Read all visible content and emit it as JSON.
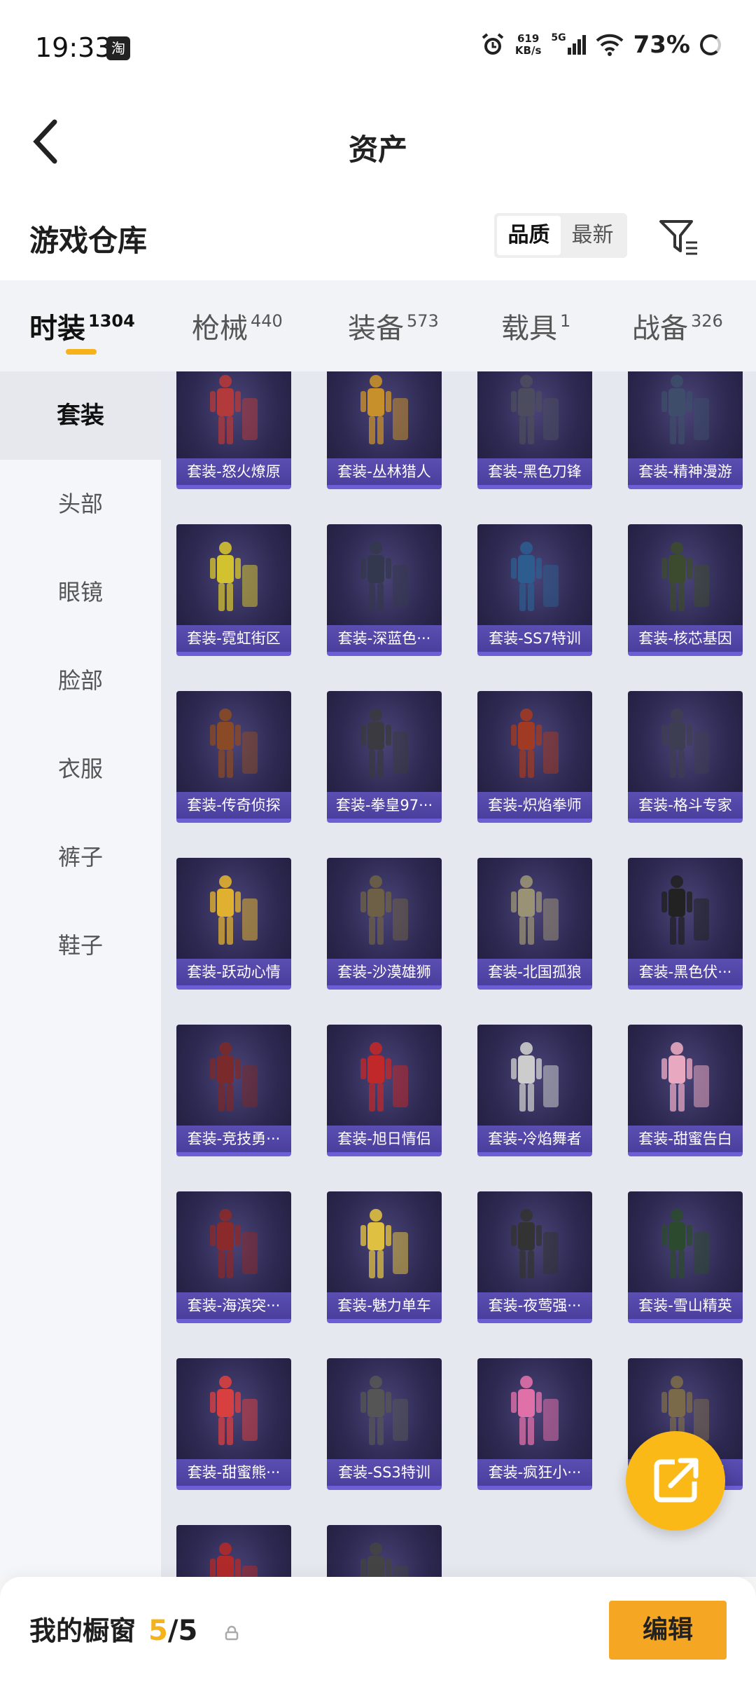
{
  "status_bar": {
    "time": "19:33",
    "app_badge": "淘",
    "net_speed": "619",
    "net_unit": "KB/s",
    "network": "5G",
    "battery": "73%"
  },
  "header": {
    "title": "资产"
  },
  "section": {
    "title": "游戏仓库",
    "sort_options": [
      "品质",
      "最新"
    ],
    "sort_selected": "品质"
  },
  "tabs": [
    {
      "label": "时装",
      "count": "1304"
    },
    {
      "label": "枪械",
      "count": "440"
    },
    {
      "label": "装备",
      "count": "573"
    },
    {
      "label": "载具",
      "count": "1"
    },
    {
      "label": "战备",
      "count": "326"
    }
  ],
  "sidebar": {
    "items": [
      "套装",
      "头部",
      "眼镜",
      "脸部",
      "衣服",
      "裤子",
      "鞋子"
    ]
  },
  "items": [
    "套装-怒火燎原",
    "套装-丛林猎人",
    "套装-黑色刀锋",
    "套装-精神漫游",
    "套装-霓虹街区",
    "套装-深蓝色···",
    "套装-SS7特训",
    "套装-核芯基因",
    "套装-传奇侦探",
    "套装-拳皇97···",
    "套装-炽焰拳师",
    "套装-格斗专家",
    "套装-跃动心情",
    "套装-沙漠雄狮",
    "套装-北国孤狼",
    "套装-黑色伏···",
    "套装-竞技勇···",
    "套装-旭日情侣",
    "套装-冷焰舞者",
    "套装-甜蜜告白",
    "套装-海滨突···",
    "套装-魅力单车",
    "套装-夜莺强···",
    "套装-雪山精英",
    "套装-甜蜜熊···",
    "套装-SS3特训",
    "套装-疯狂小···",
    "套装-···特训",
    "",
    ""
  ],
  "bottom_bar": {
    "label": "我的橱窗",
    "count_current": "5",
    "count_total": "/5",
    "edit_label": "编辑"
  },
  "colors": {
    "accent": "#f5b21b",
    "card_label": "#4a3f9c",
    "card_bg": "#2c2850"
  }
}
